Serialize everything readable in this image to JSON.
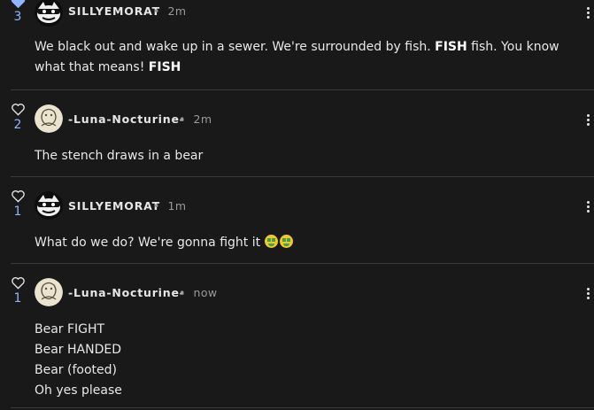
{
  "comments": [
    {
      "user": "SILLYEMORAT",
      "time": "2m",
      "likes": "3",
      "liked": true,
      "avatar": "cat-mask-avatar",
      "text_parts": [
        "We black out and wake up in a sewer. We're surrounded by fish. ",
        "FISH",
        " fish. You know what that means! ",
        "FISH"
      ]
    },
    {
      "user": "-Luna-Nocturine-",
      "time": "2m",
      "likes": "2",
      "liked": false,
      "avatar": "sketch-creature-avatar",
      "text": "The stench draws in a bear"
    },
    {
      "user": "SILLYEMORAT",
      "time": "1m",
      "likes": "1",
      "liked": false,
      "avatar": "cat-mask-avatar",
      "text": "What do we do? We're gonna fight it ",
      "emoji": "money-mouth-face"
    },
    {
      "user": "-Luna-Nocturine-",
      "time": "now",
      "likes": "1",
      "liked": false,
      "avatar": "sketch-creature-avatar",
      "lines": [
        "Bear FIGHT",
        "Bear HANDED",
        "Bear (footed)",
        "Oh yes please"
      ]
    }
  ],
  "separator": "•",
  "colors": {
    "background": "#191919",
    "accent": "#8fb6ff",
    "meta": "#9a9a9a"
  }
}
